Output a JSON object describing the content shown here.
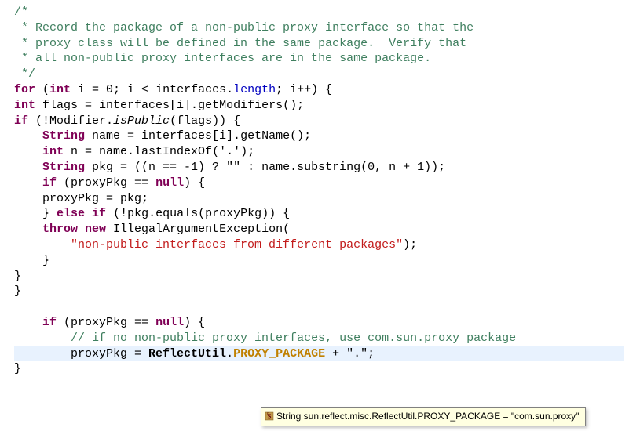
{
  "code": {
    "c1": "/*",
    "c2": " * Record the package of a non-public proxy interface so that the",
    "c3": " * proxy class will be defined in the same package.  Verify that",
    "c4": " * all non-public proxy interfaces are in the same package.",
    "c5": " */",
    "kw_for": "for",
    "kw_int1": "int",
    "for_rest": " i = 0; i < interfaces.",
    "field_length": "length",
    "for_end": "; i++) {",
    "kw_int2": "int",
    "flags_eq": " flags = interfaces[i].",
    "getModifiers": "getModifiers",
    "emptyCall": "();",
    "kw_if1": "if",
    "if1_open": " (!Modifier.",
    "isPublic": "isPublic",
    "if1_close": "(flags)) {",
    "String1": "String",
    "name_eq": " name = interfaces[i].",
    "getName": "getName",
    "kw_int3": "int",
    "n_eq": " n = name.",
    "lastIndexOf": "lastIndexOf",
    "dot_char": "'.'",
    "close_paren_semi": ");",
    "String2": "String",
    "pkg_eq": " pkg = ((n == -1) ? ",
    "empty_str": "\"\"",
    "colon_name": " : name.",
    "substring": "substring",
    "sub_args": "(0, n + 1));",
    "kw_if2": "if",
    "if2_cond": " (proxyPkg == ",
    "kw_null1": "null",
    "brace_open": ") {",
    "assign1": "proxyPkg = pkg;",
    "close_else": "} ",
    "kw_else": "else",
    "kw_if3": " if",
    "elseif_cond": " (!pkg.",
    "equals": "equals",
    "elseif_close": "(proxyPkg)) {",
    "kw_throw": "throw",
    "kw_new": " new",
    "IAE": " IllegalArgumentException(",
    "err_str": "\"non-public interfaces from different packages\"",
    "close2": ");",
    "brace1": "    }",
    "brace2": "}",
    "brace3": "}",
    "kw_if4": "if",
    "if4_cond": " (proxyPkg == ",
    "kw_null2": "null",
    "brace_open2": ") {",
    "c6": "// if no non-public proxy interfaces, use com.sun.proxy package",
    "assign2_lhs": "proxyPkg = ",
    "ReflectUtil": "ReflectUtil",
    "dot": ".",
    "PROXY_PACKAGE": "PROXY_PACKAGE",
    "plus": " + ",
    "dot_str": "\".\"",
    "semi": ";",
    "brace4": "}"
  },
  "tooltip": {
    "text": "String sun.reflect.misc.ReflectUtil.PROXY_PACKAGE = \"com.sun.proxy\""
  }
}
